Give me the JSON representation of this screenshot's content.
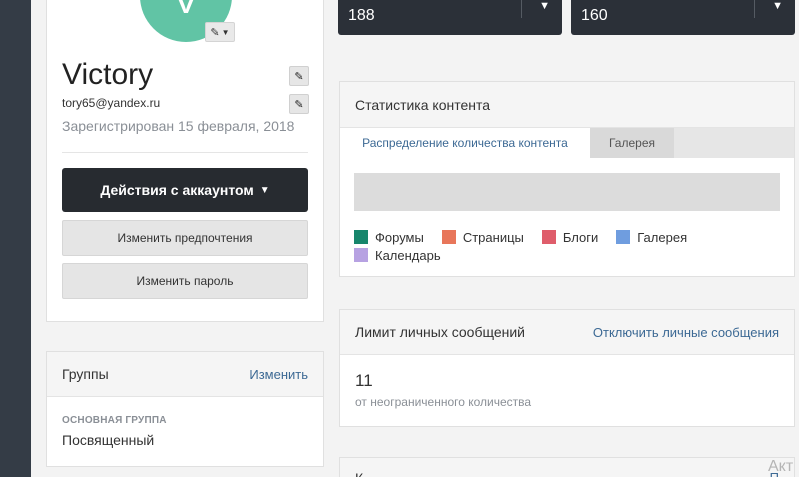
{
  "profile": {
    "avatar_letter": "V",
    "name": "Victory",
    "email": "tory65@yandex.ru",
    "registered": "Зарегистрирован 15 февраля, 2018",
    "account_actions_label": "Действия с аккаунтом",
    "change_preferences_label": "Изменить предпочтения",
    "change_password_label": "Изменить пароль"
  },
  "groups": {
    "title": "Группы",
    "edit_label": "Изменить",
    "primary_group_label": "ОСНОВНАЯ ГРУППА",
    "primary_group_value": "Посвященный"
  },
  "stats": [
    {
      "value": "188"
    },
    {
      "value": "160"
    }
  ],
  "content_stats": {
    "title": "Статистика контента",
    "tabs": [
      {
        "label": "Распределение количества контента"
      },
      {
        "label": "Галерея"
      }
    ],
    "legend": [
      {
        "label": "Форумы",
        "color": "#17866c"
      },
      {
        "label": "Страницы",
        "color": "#e8765a"
      },
      {
        "label": "Блоги",
        "color": "#df5d6b"
      },
      {
        "label": "Галерея",
        "color": "#6f9ddf"
      },
      {
        "label": "Календарь",
        "color": "#b7a2e2"
      }
    ]
  },
  "pm_limit": {
    "title": "Лимит личных сообщений",
    "disable_label": "Отключить личные сообщения",
    "count": "11",
    "subtitle": "от неограниченного количества"
  },
  "bottom_card": {
    "title_partial": "К",
    "link_partial": "П"
  },
  "watermark": "Акт"
}
